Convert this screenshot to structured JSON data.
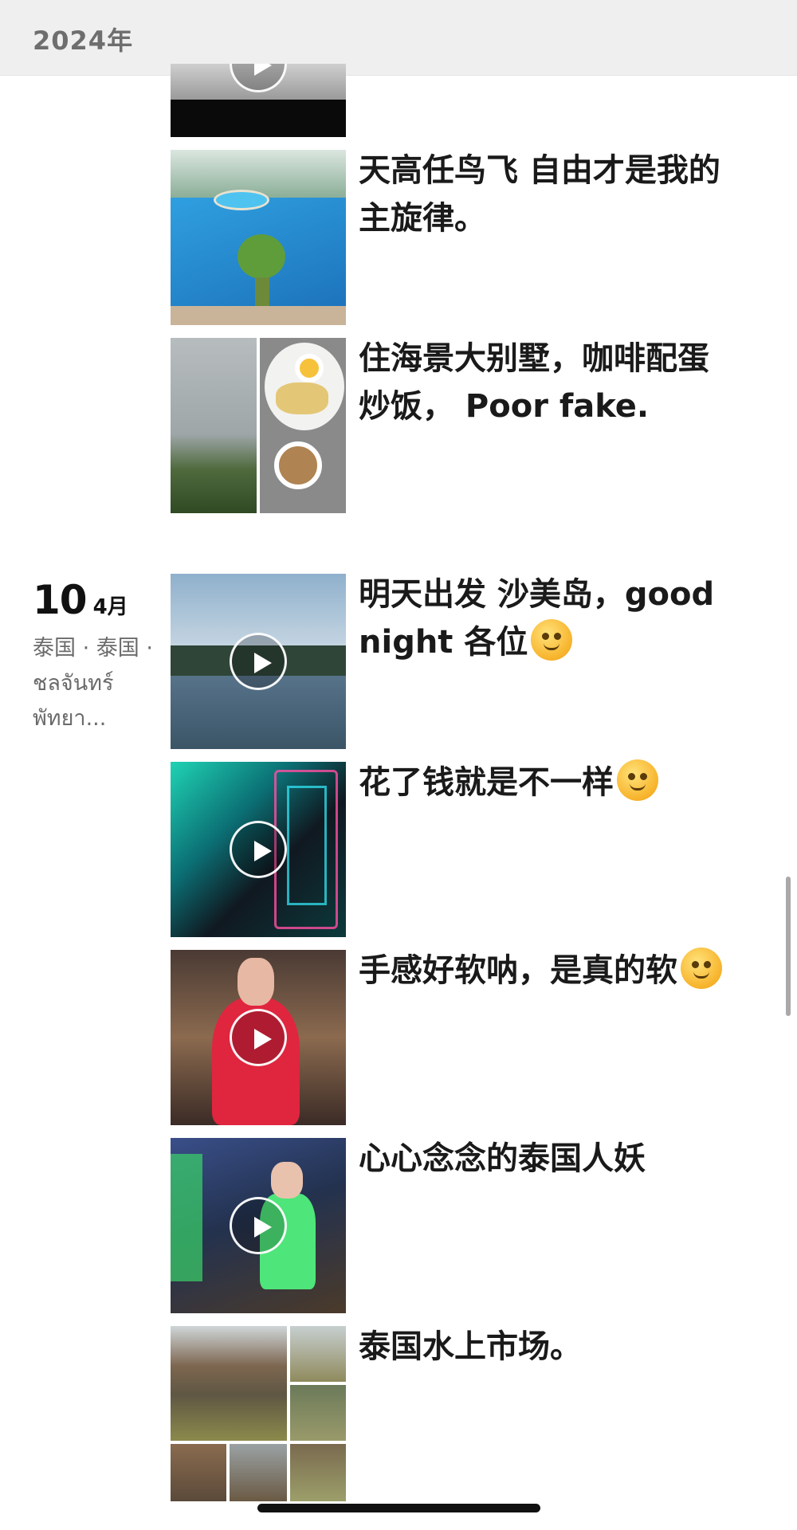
{
  "header": {
    "year": "2024年"
  },
  "date_group": {
    "day": "10",
    "month": "4月",
    "location": "泰国 · 泰国 · ชลจันทร์ พัทยา..."
  },
  "posts": [
    {
      "text": "",
      "media": "video",
      "icon": "play-icon"
    },
    {
      "text": "天高任鸟飞 自由才是我的主旋律。",
      "media": "photo",
      "icon": "pool-photo"
    },
    {
      "text": "住海景大别墅，咖啡配蛋炒饭， Poor fake.",
      "media": "photo-grid",
      "icon": "sea-and-breakfast-photos"
    },
    {
      "text": "明天出发 沙美岛，good night 各位",
      "media": "video",
      "icon": "play-icon",
      "emoji": "salute-emoji"
    },
    {
      "text": "花了钱就是不一样",
      "media": "video",
      "icon": "play-icon",
      "emoji": "smiling-emoji"
    },
    {
      "text": "手感好软呐，是真的软",
      "media": "video",
      "icon": "play-icon",
      "emoji": "wink-emoji"
    },
    {
      "text": "心心念念的泰国人妖",
      "media": "video",
      "icon": "play-icon"
    },
    {
      "text": "泰国水上市场。",
      "media": "photo-grid",
      "icon": "floating-market-photos"
    }
  ],
  "colors": {
    "header_bg": "#efefef",
    "header_text": "#6e6e6e",
    "body_text": "#1a1a1a",
    "location_text": "#6b6b6b",
    "scrollbar": "#a9a9a9"
  }
}
